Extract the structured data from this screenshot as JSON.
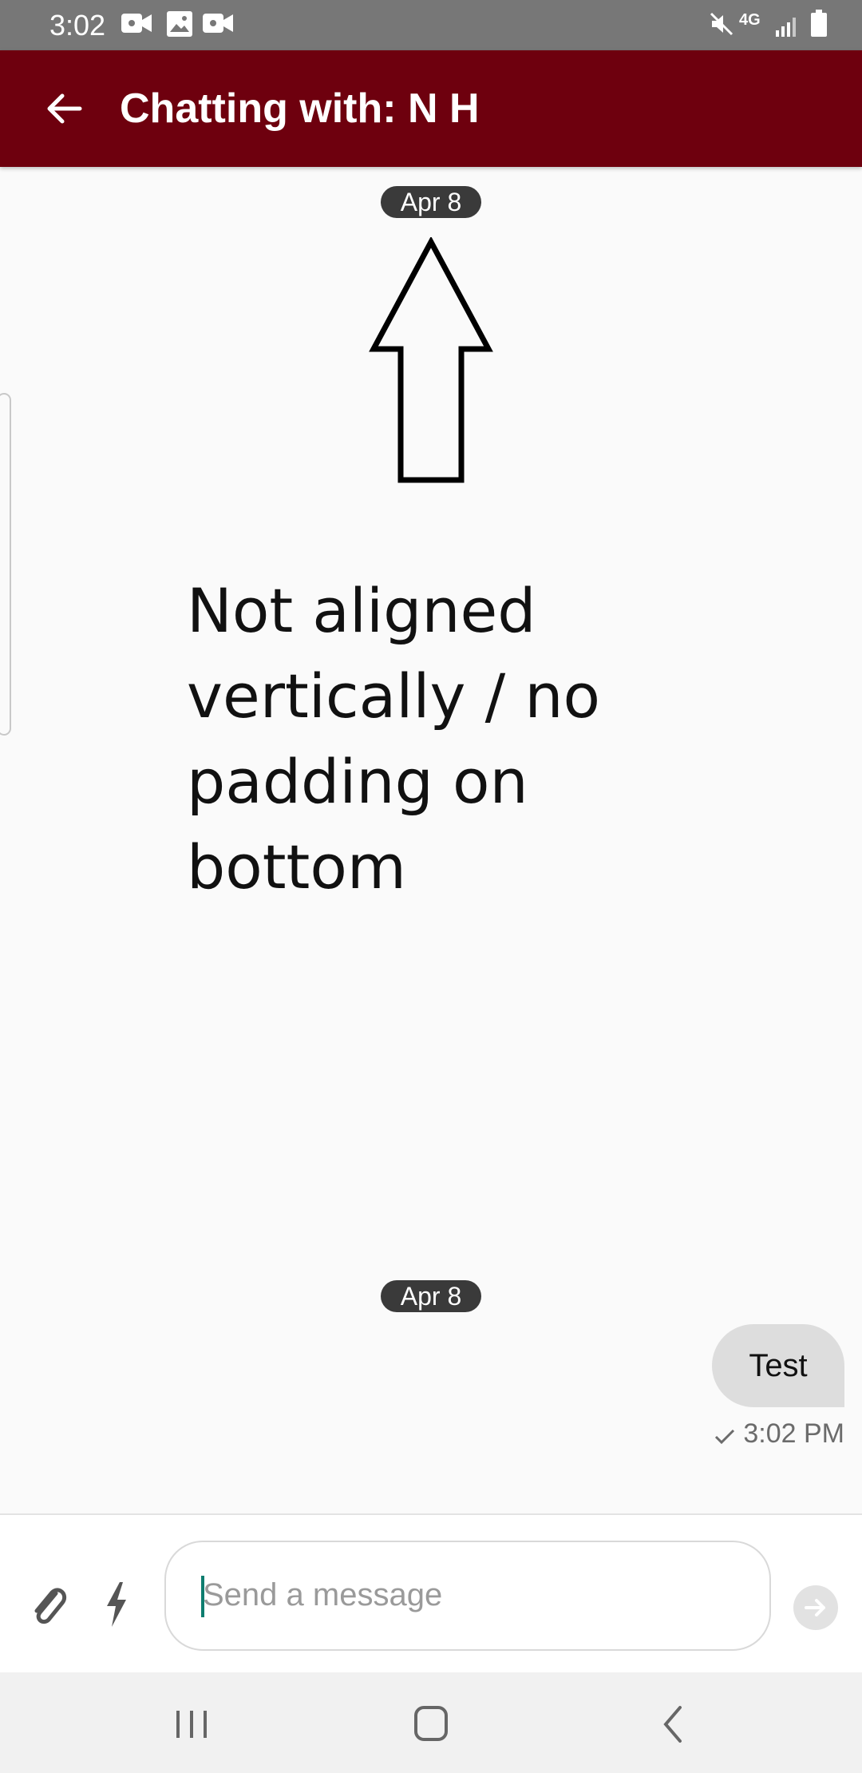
{
  "status_bar": {
    "time": "3:02",
    "left_icons": [
      "video-icon",
      "image-icon",
      "video-icon"
    ],
    "right_icons": [
      "mute-icon",
      "network-4g-icon",
      "signal-icon",
      "battery-icon"
    ],
    "network_label": "4G"
  },
  "app_bar": {
    "title": "Chatting with: N H",
    "background_color": "#6e000e"
  },
  "chat": {
    "date_chip_top": "Apr 8",
    "annotation_text": "Not aligned\nvertically / no\npadding on\nbottom",
    "date_chip_bottom": "Apr 8",
    "messages": [
      {
        "text": "Test",
        "time": "3:02 PM",
        "status_icon": "check-icon"
      }
    ]
  },
  "composer": {
    "placeholder": "Send a message",
    "attach_icon": "paperclip-icon",
    "quick_icon": "lightning-icon",
    "send_icon": "arrow-right-icon"
  },
  "nav_bar": {
    "buttons": [
      "recents-icon",
      "home-icon",
      "back-icon"
    ]
  }
}
